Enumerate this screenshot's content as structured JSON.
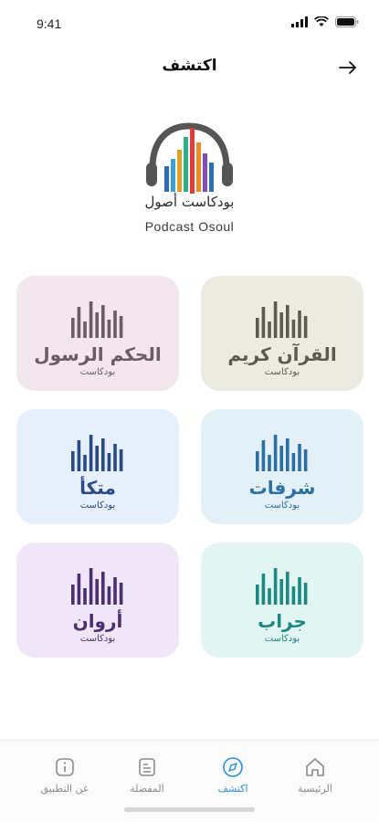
{
  "status_bar": {
    "time": "9:41"
  },
  "header": {
    "title": "اكتشف",
    "back_icon": "arrow-right-icon"
  },
  "logo": {
    "arabic": "بودكاست أصول",
    "english": "Podcast Osoul"
  },
  "podcasts": [
    {
      "title": "القرآن كريم",
      "subtitle": "بودكاست",
      "bg": "#ecebe1",
      "color": "#5b5b4e"
    },
    {
      "title": "الحكم الرسول",
      "subtitle": "بودكاست",
      "bg": "#f1e7ec",
      "color": "#6b5c66"
    },
    {
      "title": "شرفات",
      "subtitle": "بودكاست",
      "bg": "#e3f0f8",
      "color": "#2c6fa5"
    },
    {
      "title": "متكأ",
      "subtitle": "بودكاست",
      "bg": "#e6effc",
      "color": "#2a4a86"
    },
    {
      "title": "جراب",
      "subtitle": "بودكاست",
      "bg": "#e2f5f2",
      "color": "#1a8a82"
    },
    {
      "title": "أروان",
      "subtitle": "بودكاست",
      "bg": "#efe7f7",
      "color": "#4b2f70"
    }
  ],
  "tabs": [
    {
      "label": "الرئيسية",
      "icon": "home-icon",
      "active": false
    },
    {
      "label": "اكتشف",
      "icon": "compass-icon",
      "active": true
    },
    {
      "label": "المفضلة",
      "icon": "list-icon",
      "active": false
    },
    {
      "label": "عن التطبيق",
      "icon": "info-icon",
      "active": false
    }
  ],
  "colors": {
    "accent": "#2c8fd6",
    "inactive": "#8a8a8a"
  }
}
